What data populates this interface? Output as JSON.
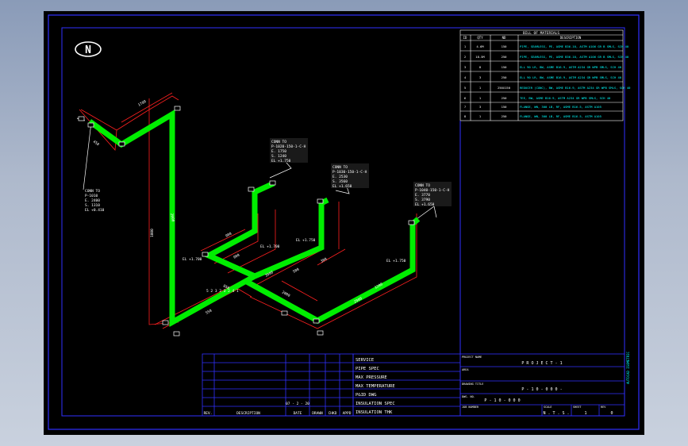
{
  "north_label": "N",
  "bom": {
    "title": "BILL OF MATERIALS",
    "headers": [
      "ID",
      "QTY",
      "ND",
      "DESCRIPTION"
    ],
    "rows": [
      {
        "id": "1",
        "qty": "4.6M",
        "nd": "150",
        "desc": "PIPE, SEAMLESS, PE, ASME B36.10, ASTM A106 GR B SMLS, SCH 40"
      },
      {
        "id": "2",
        "qty": "18.5M",
        "nd": "250",
        "desc": "PIPE, SEAMLESS, PE, ASME B36.10, ASTM A106 GR B SMLS, SCH 40"
      },
      {
        "id": "3",
        "qty": "8",
        "nd": "150",
        "desc": "ELL 90 LR, BW, ASME B16.9, ASTM A234 GR WPB SMLS, SCH 40"
      },
      {
        "id": "4",
        "qty": "3",
        "nd": "250",
        "desc": "ELL 90 LR, BW, ASME B16.9, ASTM A234 GR WPB SMLS, SCH 40"
      },
      {
        "id": "5",
        "qty": "1",
        "nd": "250X150",
        "desc": "REDUCER (CONC), BW, ASME B16.9, ASTM A234 GR WPB SMLS, SCH 40"
      },
      {
        "id": "6",
        "qty": "1",
        "nd": "250",
        "desc": "TEE, BW, ASME B16.9, ASTM A234 GR WPB SMLS, SCH 40"
      },
      {
        "id": "7",
        "qty": "3",
        "nd": "150",
        "desc": "FLANGE, WN, 300 LB, RF, ASME B16.5, ASTM A105"
      },
      {
        "id": "8",
        "qty": "1",
        "nd": "250",
        "desc": "FLANGE, WN, 300 LB, RF, ASME B16.5, ASTM A105"
      }
    ]
  },
  "callouts": {
    "left": [
      "CONN TO",
      "P-1010",
      "E. 2400",
      "S. 1310",
      "EL +0.410"
    ],
    "c1": [
      "CONN TO",
      "P-1020-150-1-C-H",
      "E. 1750",
      "S. 1240",
      "EL +1.750"
    ],
    "c2": [
      "CONN TO",
      "P-1030-150-1-C-H",
      "E. 2530",
      "S. 3560",
      "EL +1.650"
    ],
    "c3": [
      "CONN TO",
      "P-1040-150-1-C-H",
      "E. 3770",
      "S. 3790",
      "EL +1.650"
    ]
  },
  "elevations": [
    "EL +1.700",
    "EL +1.700",
    "EL +1.750",
    "EL +1.750"
  ],
  "dims": [
    "1700",
    "450",
    "1000",
    "2000",
    "550",
    "900",
    "900",
    "3000",
    "500",
    "2000",
    "1200",
    "2000",
    "850",
    "300"
  ],
  "spool_tag": "5 2 3 2 3 2 4 1",
  "revision_table": {
    "headers": [
      "REV.",
      "DESCRIPTION",
      "DATE",
      "DRAWN",
      "CHKD",
      "APPD"
    ],
    "date_value": "07 - 2 - 20"
  },
  "spec_labels": [
    "SERVICE",
    "PIPE SPEC",
    "MAX PRESSURE",
    "MAX TEMPERATURE",
    "P&ID DWG",
    "INSULATION SPEC",
    "INSULATION THK"
  ],
  "title_block": {
    "project_name_label": "PROJECT NAME",
    "project_name": "P R O J E C T - 1",
    "area_label": "AREA",
    "drawing_title_label": "DRAWING TITLE",
    "drawing_title": "P - 1 0 - 0 0 0 -",
    "dwg_no_label": "DWG. NO.",
    "dwg_no": "P - 1 0 - 0 0 0",
    "job_number_label": "JOB NUMBER",
    "scale_label": "SCALE",
    "scale": "N . T . S .",
    "sheet_label": "SHEET",
    "sheet": "1",
    "rev_label": "REV",
    "rev": "0"
  },
  "side_text": "AUTOCAD ISOMETRIC"
}
